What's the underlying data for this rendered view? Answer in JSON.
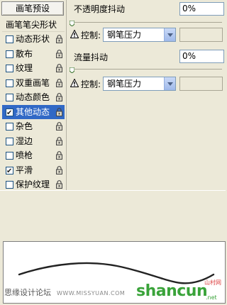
{
  "preset_button": "画笔预设",
  "tip_shape_label": "画笔笔尖形状",
  "items": [
    {
      "label": "动态形状",
      "checked": false,
      "selected": false
    },
    {
      "label": "散布",
      "checked": false,
      "selected": false
    },
    {
      "label": "纹理",
      "checked": false,
      "selected": false
    },
    {
      "label": "双重画笔",
      "checked": false,
      "selected": false
    },
    {
      "label": "动态颜色",
      "checked": false,
      "selected": false
    },
    {
      "label": "其他动态",
      "checked": true,
      "selected": true
    },
    {
      "label": "杂色",
      "checked": false,
      "selected": false
    },
    {
      "label": "湿边",
      "checked": false,
      "selected": false
    },
    {
      "label": "喷枪",
      "checked": false,
      "selected": false
    },
    {
      "label": "平滑",
      "checked": true,
      "selected": false
    },
    {
      "label": "保护纹理",
      "checked": false,
      "selected": false
    }
  ],
  "opacity_jitter": {
    "label": "不透明度抖动",
    "value": "0%",
    "slider_fraction": 0,
    "control_label": "控制:",
    "control_value": "钢笔压力"
  },
  "flow_jitter": {
    "label": "流量抖动",
    "value": "0%",
    "slider_fraction": 0,
    "control_label": "控制:",
    "control_value": "钢笔压力"
  },
  "watermark": {
    "left_text": "思缘设计论坛",
    "site_text": "WWW.MISSYUAN.COM",
    "logo_text": "shancun",
    "small_text": "山村网",
    "net_text": ".net"
  },
  "colors": {
    "selection": "#3169c6",
    "panel": "#ece9d8",
    "field_border": "#7f9db9"
  }
}
